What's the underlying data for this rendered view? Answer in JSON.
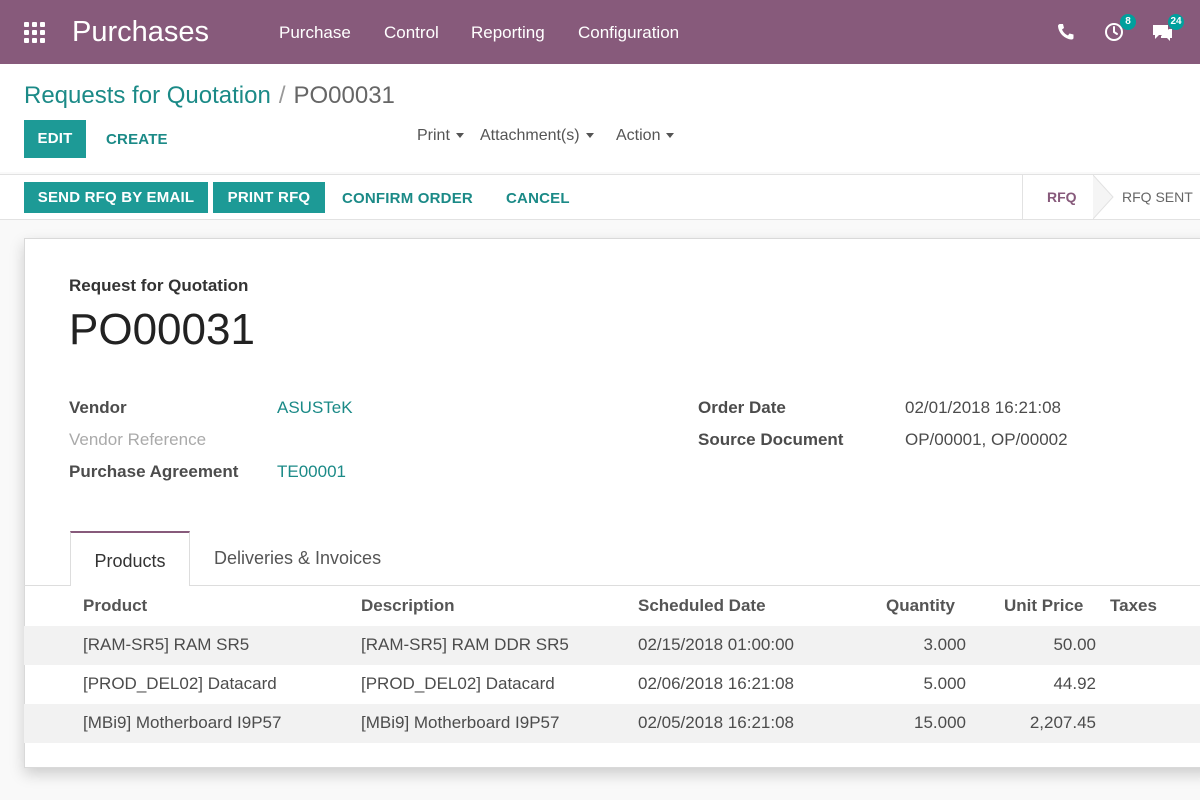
{
  "navbar": {
    "app_title": "Purchases",
    "menu": [
      "Purchase",
      "Control",
      "Reporting",
      "Configuration"
    ],
    "icons": {
      "apps": "apps-grid-icon",
      "phone": "phone-icon",
      "activities": "clock-icon",
      "messages": "chat-icon"
    },
    "activity_count": "8",
    "message_count": "24",
    "bg_color": "#875a7b"
  },
  "breadcrumb": {
    "parent": "Requests for Quotation",
    "separator": "/",
    "current": "PO00031"
  },
  "control": {
    "edit_label": "EDIT",
    "create_label": "CREATE",
    "print_label": "Print",
    "attachments_label": "Attachment(s)",
    "action_label": "Action"
  },
  "statusbar": {
    "send_rfq_label": "SEND RFQ BY EMAIL",
    "print_rfq_label": "PRINT RFQ",
    "confirm_label": "CONFIRM ORDER",
    "cancel_label": "CANCEL",
    "stages": [
      "RFQ",
      "RFQ SENT"
    ],
    "active_stage": "RFQ"
  },
  "form": {
    "doc_type": "Request for Quotation",
    "doc_name": "PO00031",
    "vendor_label": "Vendor",
    "vendor": "ASUSTeK",
    "vendor_ref_label": "Vendor Reference",
    "agreement_label": "Purchase Agreement",
    "agreement": "TE00001",
    "order_date_label": "Order Date",
    "order_date": "02/01/2018 16:21:08",
    "source_label": "Source Document",
    "source": "OP/00001, OP/00002"
  },
  "tabs": {
    "products": "Products",
    "deliveries": "Deliveries & Invoices",
    "active": "Products"
  },
  "table": {
    "headers": [
      "Product",
      "Description",
      "Scheduled Date",
      "Quantity",
      "Unit Price",
      "Taxes"
    ],
    "rows": [
      [
        "[RAM-SR5] RAM SR5",
        "[RAM-SR5] RAM DDR SR5",
        "02/15/2018 01:00:00",
        "3.000",
        "50.00",
        ""
      ],
      [
        "[PROD_DEL02] Datacard",
        "[PROD_DEL02] Datacard",
        "02/06/2018 16:21:08",
        "5.000",
        "44.92",
        ""
      ],
      [
        "[MBi9] Motherboard I9P57",
        "[MBi9] Motherboard I9P57",
        "02/05/2018 16:21:08",
        "15.000",
        "2,207.45",
        ""
      ]
    ]
  },
  "colors": {
    "primary": "#875a7b",
    "accent": "#1d9a96",
    "link": "#1b8a87"
  }
}
